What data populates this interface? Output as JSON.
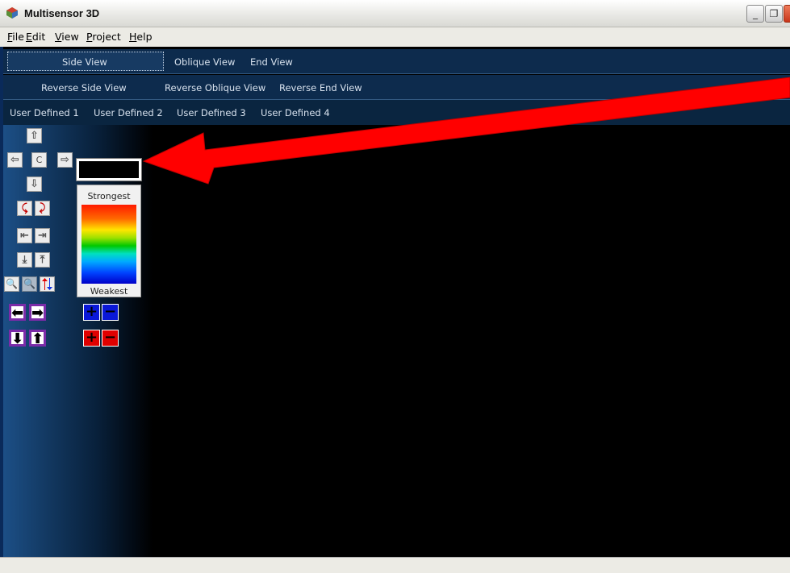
{
  "window": {
    "title": "Multisensor 3D"
  },
  "menu": {
    "items": [
      {
        "label": "File",
        "mnemonic": "F",
        "rest": "ile"
      },
      {
        "label": "Edit",
        "mnemonic": "E",
        "rest": "dit"
      },
      {
        "label": "View",
        "mnemonic": "V",
        "rest": "iew"
      },
      {
        "label": "Project",
        "mnemonic": "P",
        "rest": "roject"
      },
      {
        "label": "Help",
        "mnemonic": "H",
        "rest": "elp"
      }
    ]
  },
  "view_tabs": {
    "row1": [
      "Side View",
      "Oblique View",
      "End View"
    ],
    "row2": [
      "Reverse Side View",
      "Reverse Oblique View",
      "Reverse End View"
    ],
    "row3": [
      "User Defined 1",
      "User Defined 2",
      "User Defined 3",
      "User Defined 4"
    ],
    "selected": "Side View"
  },
  "toolbar": {
    "center_label": "C"
  },
  "legend": {
    "top_label": "Strongest",
    "bottom_label": "Weakest"
  },
  "icons": {
    "app": "multisensor-app-icon",
    "pan_up": "arrow-up-icon",
    "pan_down": "arrow-down-icon",
    "pan_left": "arrow-left-icon",
    "pan_right": "arrow-right-icon",
    "zoom_in": "zoom-in-icon",
    "zoom_out": "zoom-out-icon"
  },
  "colors": {
    "tab_background": "#0d2b4d",
    "annotation_arrow": "#ff0000",
    "purple_frame": "#7b2ba8",
    "plus_blue": "#0a18d8",
    "plus_red": "#e00000"
  }
}
